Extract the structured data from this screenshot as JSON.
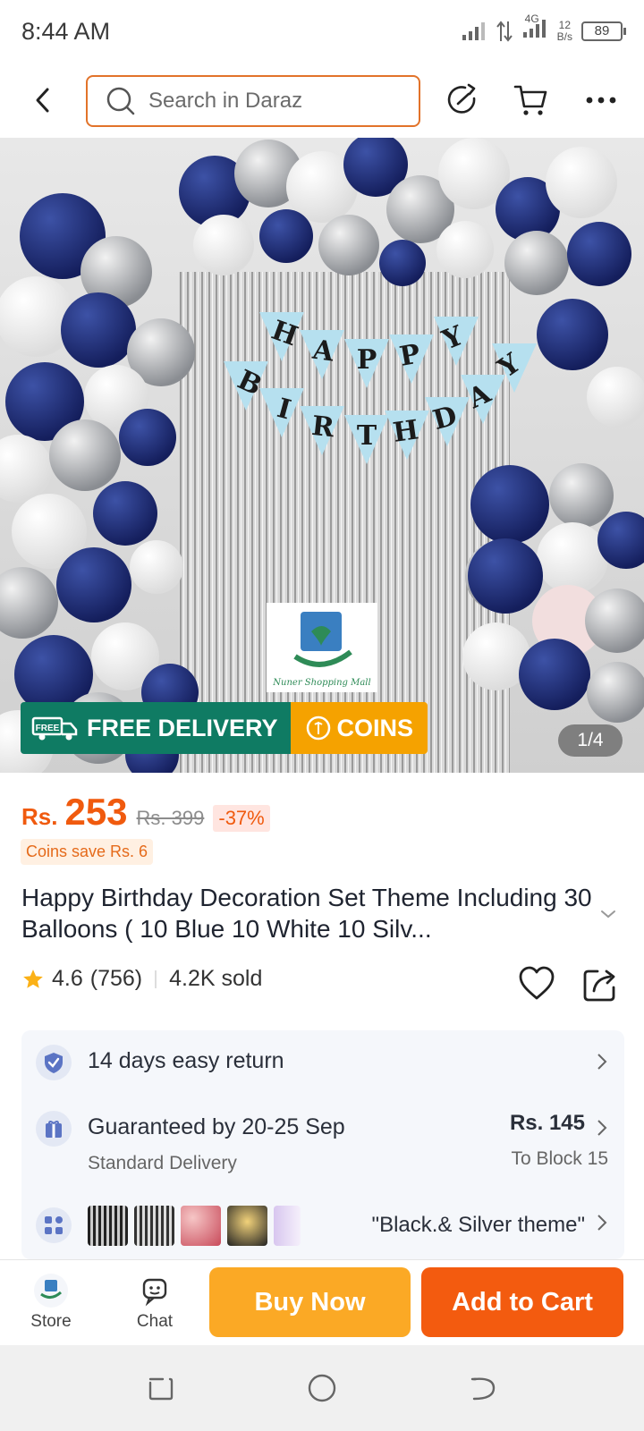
{
  "status_bar": {
    "time": "8:44 AM",
    "network": "4G",
    "speed_value": "12",
    "speed_unit": "B/s",
    "battery": "89"
  },
  "header": {
    "search_placeholder": "Search in Daraz",
    "icons": [
      "back-arrow-icon",
      "search-icon",
      "share-icon",
      "cart-icon",
      "more-icon"
    ]
  },
  "hero": {
    "banner_letters_top": "HAPPY",
    "banner_letters_bottom": "BIRTHDAY",
    "store_caption": "Nuner Shopping Mall",
    "free_delivery_tag": "FREE",
    "free_delivery_label": "FREE DELIVERY",
    "coins_label": "COINS",
    "pager": "1/4"
  },
  "product": {
    "currency": "Rs.",
    "price": "253",
    "old_price": "Rs. 399",
    "discount": "-37%",
    "coins_save": "Coins save Rs. 6",
    "title": "Happy Birthday Decoration Set Theme Including 30 Balloons ( 10 Blue 10 White 10 Silv...",
    "rating": "4.6",
    "reviews": "(756)",
    "sold": "4.2K sold"
  },
  "info": {
    "return_text": "14 days easy return",
    "delivery_text": "Guaranteed by 20-25 Sep",
    "delivery_type": "Standard Delivery",
    "delivery_price": "Rs. 145",
    "delivery_location": "To Block 15",
    "variant_text": "\"Black.& Silver theme\""
  },
  "bottom_bar": {
    "store_label": "Store",
    "chat_label": "Chat",
    "buy_now": "Buy Now",
    "add_to_cart": "Add to Cart"
  },
  "colors": {
    "accent_orange": "#f35b0f",
    "buy_yellow": "#fba925",
    "delivery_green": "#0f7b63",
    "coins_orange": "#f5a200",
    "search_border": "#e2732a"
  }
}
